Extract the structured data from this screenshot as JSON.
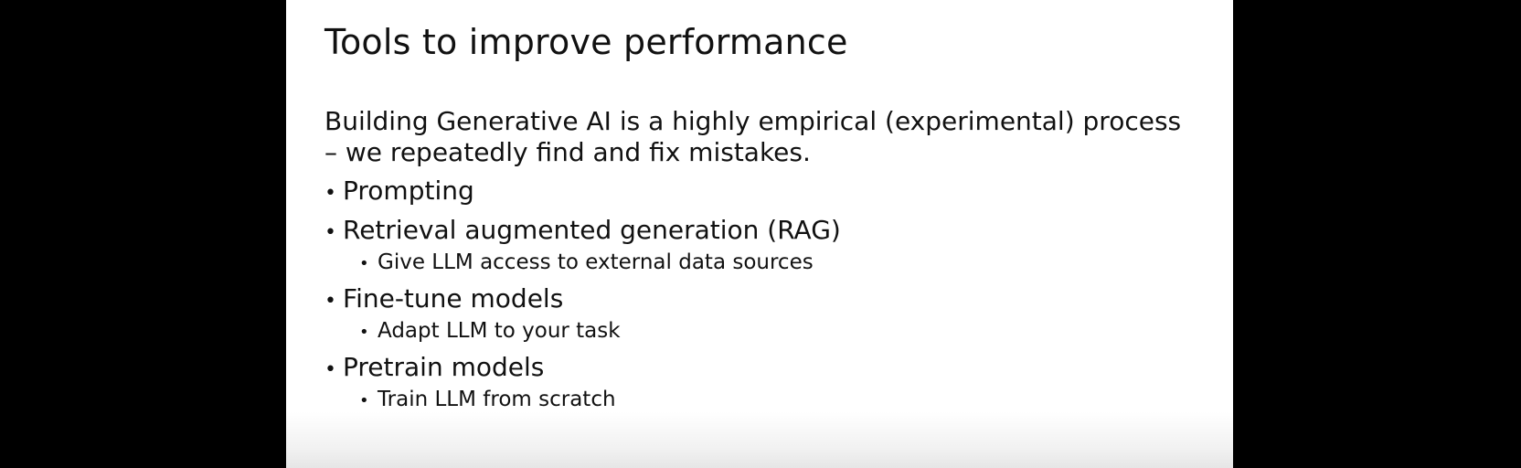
{
  "slide": {
    "title": "Tools to improve performance",
    "intro": "Building Generative AI is a highly empirical (experimental) process – we repeatedly find and fix mistakes.",
    "bullets": [
      {
        "label": "Prompting",
        "sub": []
      },
      {
        "label": "Retrieval augmented generation (RAG)",
        "sub": [
          "Give LLM access to external data sources"
        ]
      },
      {
        "label": "Fine-tune models",
        "sub": [
          "Adapt LLM to your task"
        ]
      },
      {
        "label": "Pretrain models",
        "sub": [
          "Train LLM from scratch"
        ]
      }
    ]
  },
  "colors": {
    "background": "#000000",
    "slide": "#ffffff",
    "text": "#111111"
  }
}
